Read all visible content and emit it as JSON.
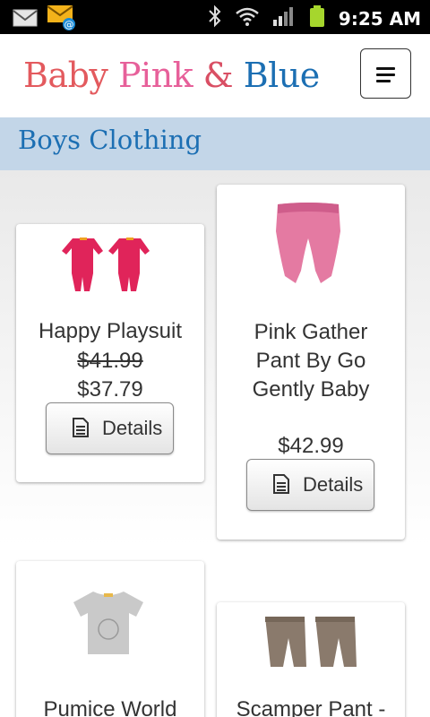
{
  "status_bar": {
    "time": "9:25 AM",
    "icons": [
      "gmail-icon",
      "email-notification-icon",
      "bluetooth-icon",
      "wifi-icon",
      "signal-icon",
      "battery-icon"
    ],
    "battery_color": "#a6d62d"
  },
  "header": {
    "logo_words": [
      "Baby",
      "Pink",
      "&",
      "Blue"
    ],
    "logo_colors": [
      "#e35a5e",
      "#e7609a",
      "#d94f64",
      "#1c6fb3"
    ],
    "menu_icon": "hamburger-menu-icon"
  },
  "category": {
    "title": "Boys Clothing",
    "background": "#c3d6e8",
    "color": "#1c6fb3"
  },
  "products": [
    {
      "name": "Happy Playsuit",
      "old_price": "$41.99",
      "price": "$37.79",
      "details_label": "Details",
      "image_color": "#e0245a"
    },
    {
      "name": "Pink Gather Pant By Go Gently Baby",
      "old_price": "",
      "price": "$42.99",
      "details_label": "Details",
      "image_color": "#e47aa2"
    },
    {
      "name": "Pumice World",
      "old_price": "",
      "price": "",
      "details_label": "",
      "image_color": "#c9c9c9"
    },
    {
      "name": "Scamper Pant -",
      "old_price": "",
      "price": "",
      "details_label": "",
      "image_color": "#8a7a6c"
    }
  ]
}
